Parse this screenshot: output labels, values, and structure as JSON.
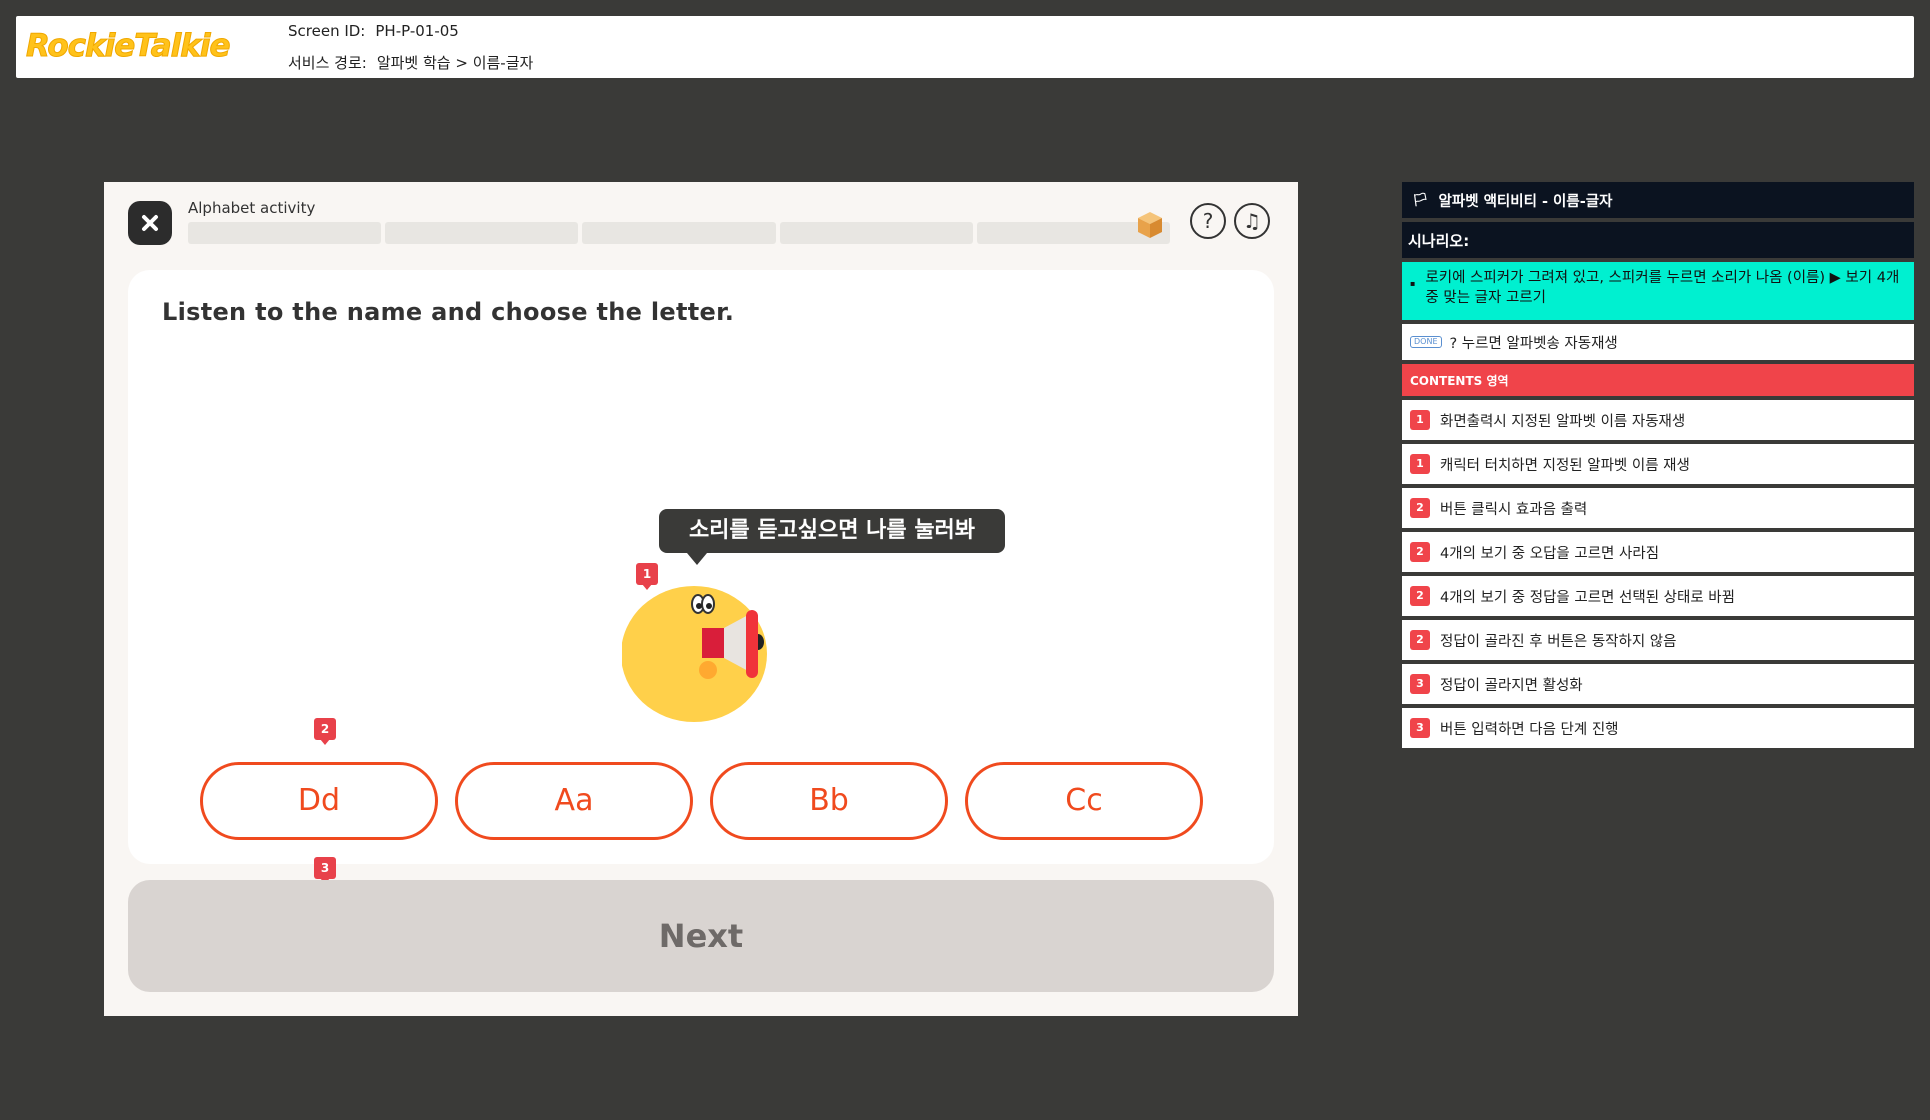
{
  "header": {
    "logo": "RockieTalkie",
    "screen_id_label": "Screen ID:",
    "screen_id": "PH-P-01-05",
    "path_label": "서비스 경로:",
    "path": "알파벳 학습 > 이름-글자"
  },
  "app": {
    "activity_label": "Alphabet activity",
    "progress_segments": 5,
    "question": "Listen to the name and choose the letter.",
    "bubble": "소리를 듣고싶으면 나를 눌러봐",
    "choices": [
      "Dd",
      "Aa",
      "Bb",
      "Cc"
    ],
    "next_label": "Next",
    "markers": {
      "character": "1",
      "choices": "2",
      "next": "3"
    }
  },
  "panel": {
    "title": "알파벳 액티비티 - 이름-글자",
    "scenario_label": "시나리오:",
    "scenario_text": "로키에 스피커가 그려져 있고, 스피커를 누르면 소리가 나옴 (이름) ▶ 보기 4개 중 맞는 글자 고르기",
    "done_tag": "DONE",
    "autoplay_note": "? 누르면 알파벳송 자동재생",
    "contents_label": "CONTENTS 영역",
    "items": [
      {
        "num": "1",
        "text": "화면출력시 지정된 알파벳 이름 자동재생"
      },
      {
        "num": "1",
        "text": "캐릭터 터치하면 지정된 알파벳 이름 재생"
      },
      {
        "num": "2",
        "text": "버튼 클릭시 효과음 출력"
      },
      {
        "num": "2",
        "text": "4개의 보기 중 오답을 고르면 사라짐"
      },
      {
        "num": "2",
        "text": "4개의 보기 중 정답을 고르면 선택된 상태로 바뀜"
      },
      {
        "num": "2",
        "text": "정답이 골라진 후 버튼은 동작하지 않음"
      },
      {
        "num": "3",
        "text": "정답이 골라지면 활성화"
      },
      {
        "num": "3",
        "text": "버튼 입력하면 다음 단계 진행"
      }
    ]
  },
  "colors": {
    "accent_orange": "#f04a1e",
    "marker_red": "#e8414a",
    "cyan": "#00f0d0",
    "logo_yellow": "#ffc21a"
  }
}
